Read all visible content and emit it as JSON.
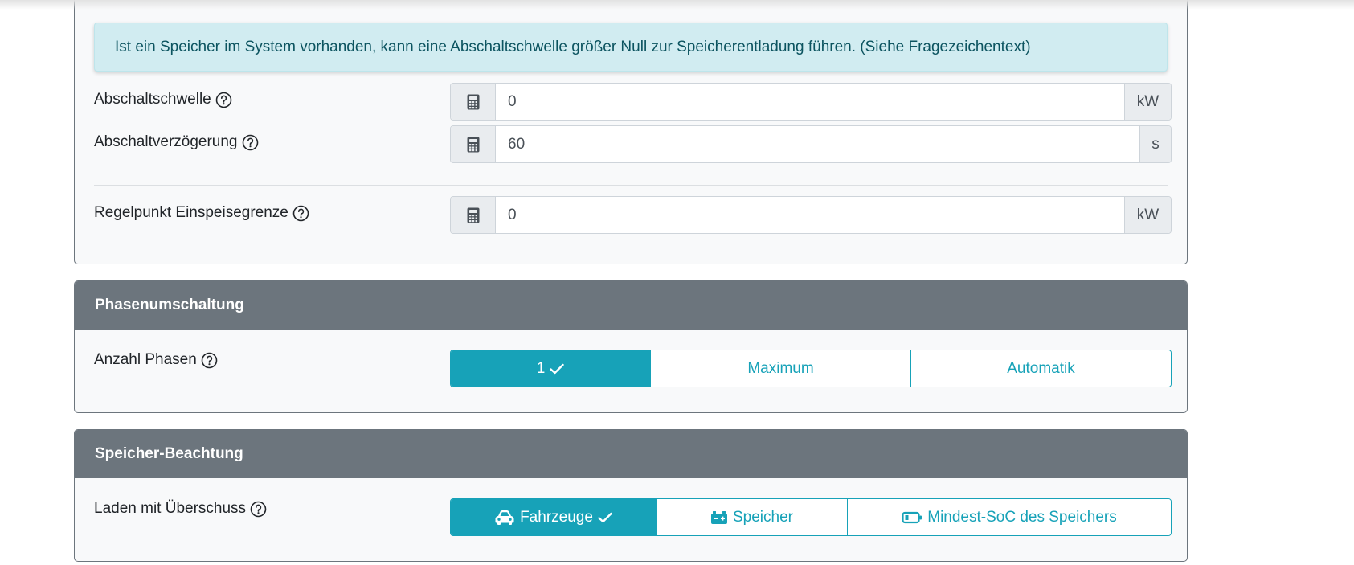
{
  "regelung": {
    "alert_text": "Ist ein Speicher im System vorhanden, kann eine Abschaltschwelle größer Null zur Speicherentladung führen. (Siehe Fragezeichentext)",
    "abschaltschwelle": {
      "label": "Abschaltschwelle",
      "value": "0",
      "unit": "kW"
    },
    "abschaltverzoegerung": {
      "label": "Abschaltverzögerung",
      "value": "60",
      "unit": "s"
    },
    "regelpunkt": {
      "label": "Regelpunkt Einspeisegrenze",
      "value": "0",
      "unit": "kW"
    }
  },
  "phasenumschaltung": {
    "title": "Phasenumschaltung",
    "label": "Anzahl Phasen",
    "options": [
      "1",
      "Maximum",
      "Automatik"
    ],
    "selected": "1"
  },
  "speicher": {
    "title": "Speicher-Beachtung",
    "label": "Laden mit Überschuss",
    "options": [
      "Fahrzeuge",
      "Speicher",
      "Mindest-SoC des Speichers"
    ],
    "selected": "Fahrzeuge"
  },
  "colors": {
    "accent": "#17a2b8",
    "card_header": "#6c757d",
    "alert_bg": "#d1ecf1",
    "alert_text": "#0c5460"
  },
  "icons": {
    "help": "question-circle-icon",
    "input_prefix": "calculator-icon",
    "selected_mark": "check-icon",
    "vehicle": "car-icon",
    "storage": "car-battery-icon",
    "soc": "battery-icon"
  }
}
